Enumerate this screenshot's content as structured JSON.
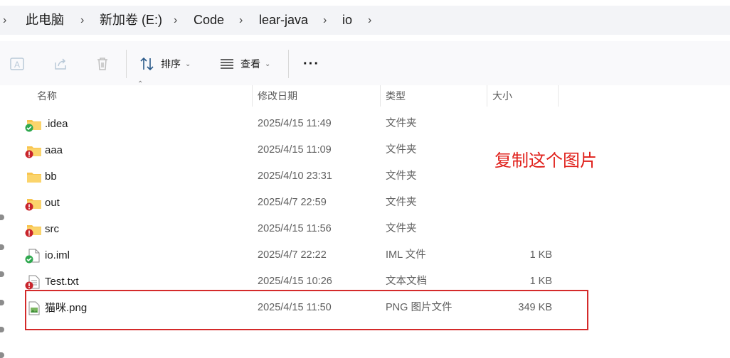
{
  "breadcrumb": {
    "items": [
      "此电脑",
      "新加卷 (E:)",
      "Code",
      "lear-java",
      "io"
    ]
  },
  "toolbar": {
    "sort_label": "排序",
    "view_label": "查看",
    "more_label": "···"
  },
  "columns": {
    "name": "名称",
    "modified": "修改日期",
    "type": "类型",
    "size": "大小"
  },
  "files": [
    {
      "name": ".idea",
      "modified": "2025/4/15 11:49",
      "type": "文件夹",
      "size": "",
      "icon": "folder-synced-icon"
    },
    {
      "name": "aaa",
      "modified": "2025/4/15 11:09",
      "type": "文件夹",
      "size": "",
      "icon": "folder-error-icon"
    },
    {
      "name": "bb",
      "modified": "2025/4/10 23:31",
      "type": "文件夹",
      "size": "",
      "icon": "folder-icon"
    },
    {
      "name": "out",
      "modified": "2025/4/7 22:59",
      "type": "文件夹",
      "size": "",
      "icon": "folder-error-icon"
    },
    {
      "name": "src",
      "modified": "2025/4/15 11:56",
      "type": "文件夹",
      "size": "",
      "icon": "folder-error-icon"
    },
    {
      "name": "io.iml",
      "modified": "2025/4/7 22:22",
      "type": "IML 文件",
      "size": "1 KB",
      "icon": "file-synced-icon"
    },
    {
      "name": "Test.txt",
      "modified": "2025/4/15 10:26",
      "type": "文本文档",
      "size": "1 KB",
      "icon": "text-file-error-icon"
    },
    {
      "name": "猫咪.png",
      "modified": "2025/4/15 11:50",
      "type": "PNG 图片文件",
      "size": "349 KB",
      "icon": "image-file-icon"
    }
  ],
  "annotation": "复制这个图片",
  "colors": {
    "annotation": "#e0201b",
    "highlight_border": "#d42a2a",
    "folder": "#f8c44e",
    "sync_ok": "#2fa84f",
    "sync_error": "#c8242b"
  }
}
